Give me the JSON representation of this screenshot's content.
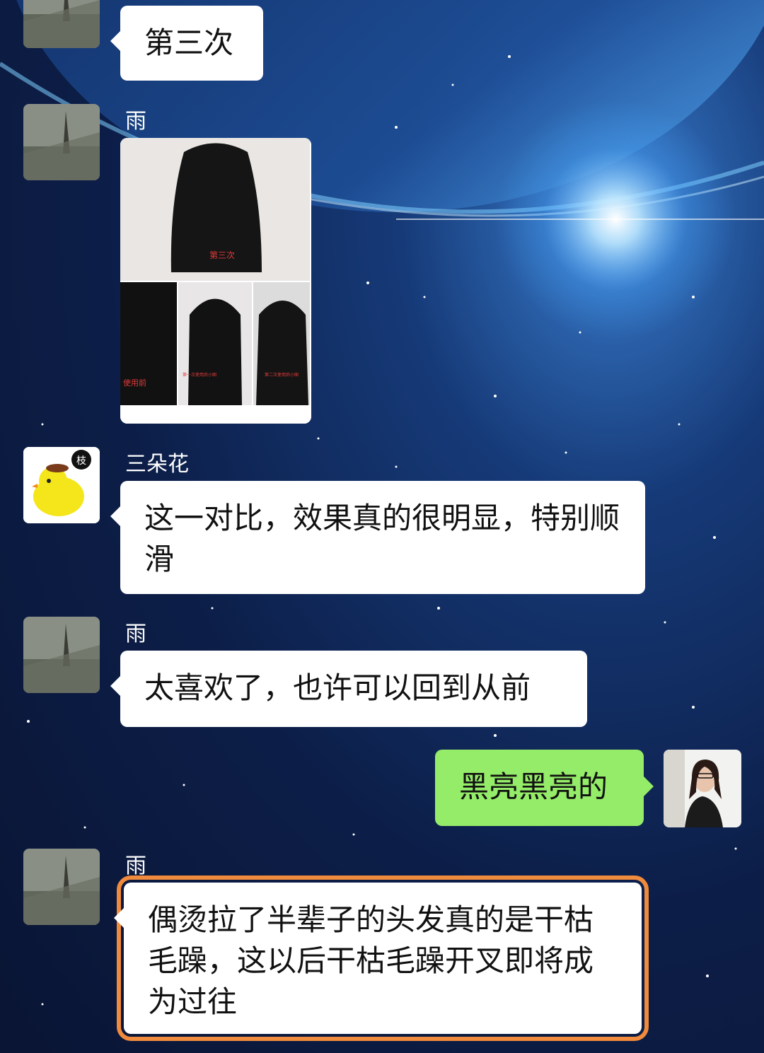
{
  "messages": [
    {
      "sender": "",
      "text": "第三次"
    },
    {
      "sender": "雨",
      "image": {
        "top_label": "第三次",
        "bottom_label_1": "使用前",
        "bottom_label_2": "第一次使用后小图",
        "bottom_label_3": "第二次使用后小图"
      }
    },
    {
      "sender": "三朵花",
      "avatar_badge": "枝",
      "text": "这一对比，效果真的很明显，特别顺滑"
    },
    {
      "sender": "雨",
      "text": "太喜欢了，也许可以回到从前"
    },
    {
      "sender": "",
      "text": "黑亮黑亮的"
    },
    {
      "sender": "雨",
      "text": "偶烫拉了半辈子的头发真的是干枯毛躁，这以后干枯毛躁开叉即将成为过往"
    }
  ],
  "colors": {
    "self_bubble": "#95ec69",
    "other_bubble": "#ffffff",
    "highlight": "#f08a3c"
  }
}
